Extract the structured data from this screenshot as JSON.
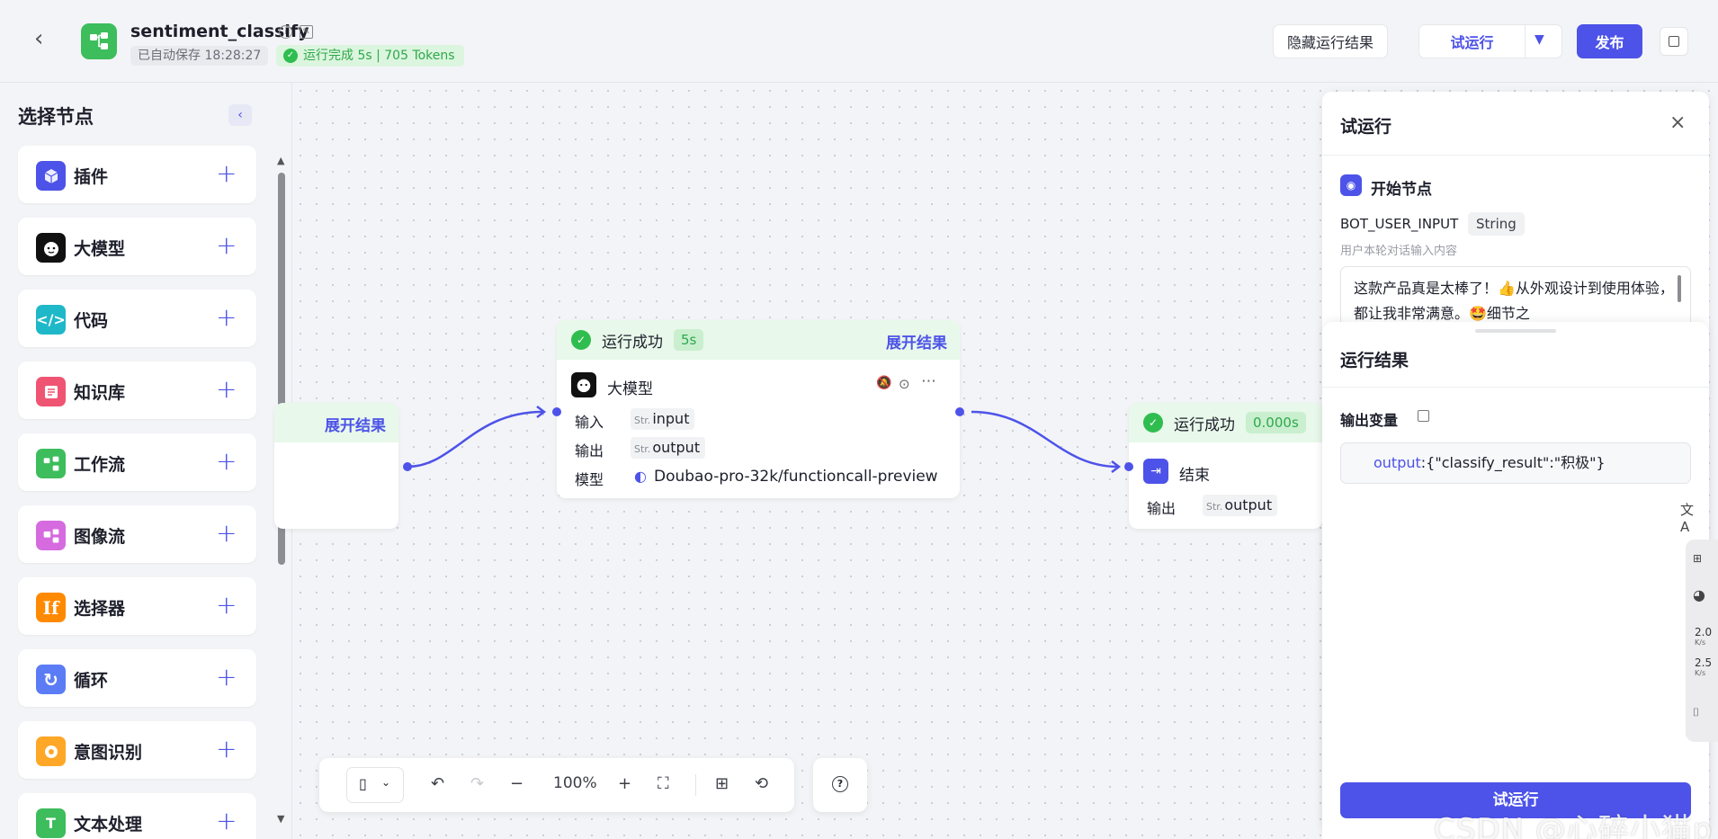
{
  "header": {
    "app_title": "sentiment_classify",
    "autosave": "已自动保存 18:28:27",
    "run_status": "运行完成 5s | 705 Tokens",
    "hide_results": "隐藏运行结果",
    "trial_run": "试运行",
    "publish": "发布"
  },
  "sidebar": {
    "title": "选择节点",
    "items": [
      {
        "label": "插件",
        "color": "#4d53e8",
        "icon": "plugin-icon"
      },
      {
        "label": "大模型",
        "color": "#111111",
        "icon": "llm-icon"
      },
      {
        "label": "代码",
        "color": "#1fb8c8",
        "icon": "code-icon"
      },
      {
        "label": "知识库",
        "color": "#f05473",
        "icon": "knowledge-icon"
      },
      {
        "label": "工作流",
        "color": "#3dbd5c",
        "icon": "workflow-icon"
      },
      {
        "label": "图像流",
        "color": "#d66be0",
        "icon": "image-flow-icon"
      },
      {
        "label": "选择器",
        "color": "#ff8a00",
        "icon": "if-icon"
      },
      {
        "label": "循环",
        "color": "#5b7cf5",
        "icon": "loop-icon"
      },
      {
        "label": "意图识别",
        "color": "#ffa726",
        "icon": "intent-icon"
      },
      {
        "label": "文本处理",
        "color": "#3dbd5c",
        "icon": "text-icon"
      }
    ]
  },
  "canvas": {
    "start_node": {
      "expand": "展开结果"
    },
    "llm_node": {
      "status": "运行成功",
      "time": "5s",
      "expand": "展开结果",
      "title": "大模型",
      "input_label": "输入",
      "input_var": "input",
      "output_label": "输出",
      "output_var": "output",
      "model_label": "模型",
      "model_value": "Doubao-pro-32k/functioncall-preview",
      "str_prefix": "Str."
    },
    "end_node": {
      "status": "运行成功",
      "time": "0.000s",
      "title": "结束",
      "output_label": "输出",
      "output_var": "output",
      "str_prefix": "Str."
    }
  },
  "panel": {
    "title": "试运行",
    "start_node_label": "开始节点",
    "var_name": "BOT_USER_INPUT",
    "var_type": "String",
    "var_desc": "用户本轮对话输入内容",
    "input_text": "这款产品真是太棒了！👍从外观设计到使用体验，都让我非常满意。🤩细节之",
    "results_title": "运行结果",
    "output_vars_label": "输出变量",
    "output_key": "output",
    "output_value": ":{\"classify_result\":\"积极\"}",
    "bottom_button": "试运行"
  },
  "toolbar": {
    "zoom": "100%"
  },
  "side_tools": {
    "speed_up": "2.0",
    "speed_down": "2.5",
    "unit": "K/s"
  },
  "watermark": "CSDN @心碎小猫p"
}
